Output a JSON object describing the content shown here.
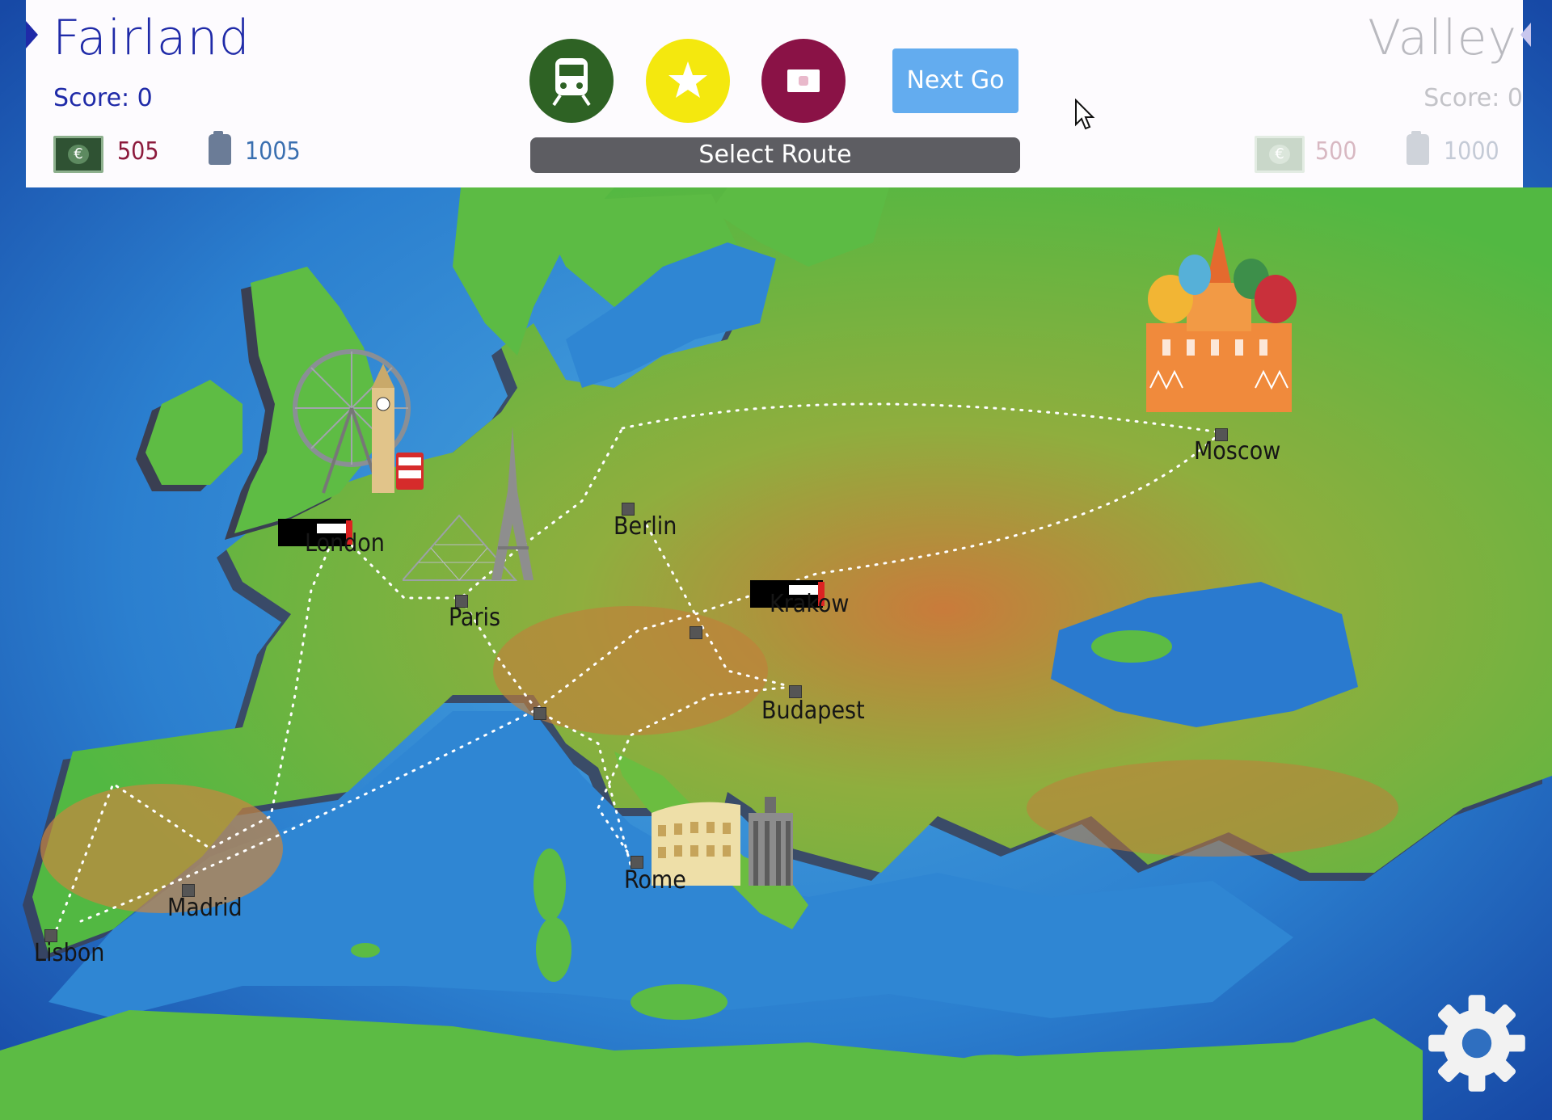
{
  "player1": {
    "name": "Fairland",
    "score": "Score: 0",
    "money": "505",
    "fuel": "1005"
  },
  "player2": {
    "name": "Valley",
    "score": "Score: 0",
    "money": "500",
    "fuel": "1000"
  },
  "actions": {
    "train_button": "train-icon",
    "star_button": "star-icon",
    "card_button": "ticket-icon",
    "next_label": "Next Go",
    "route_status": "Select Route"
  },
  "colors": {
    "player1": "#1f2aa8",
    "train_btn": "#2e6224",
    "star_btn": "#f4e80e",
    "card_btn": "#8a1246",
    "next_btn": "#63acef",
    "money_p1": "#8c1a3c",
    "fuel_p1": "#3a6fb0"
  },
  "cities": [
    {
      "name": "London"
    },
    {
      "name": "Paris"
    },
    {
      "name": "Berlin"
    },
    {
      "name": "Krakow"
    },
    {
      "name": "Budapest"
    },
    {
      "name": "Moscow"
    },
    {
      "name": "Rome"
    },
    {
      "name": "Madrid"
    },
    {
      "name": "Lisbon"
    }
  ],
  "landmarks": [
    "london-eye-big-ben",
    "louvre-eiffel-tower",
    "st-basils-cathedral",
    "colosseum"
  ],
  "settings_icon": "gear-icon"
}
